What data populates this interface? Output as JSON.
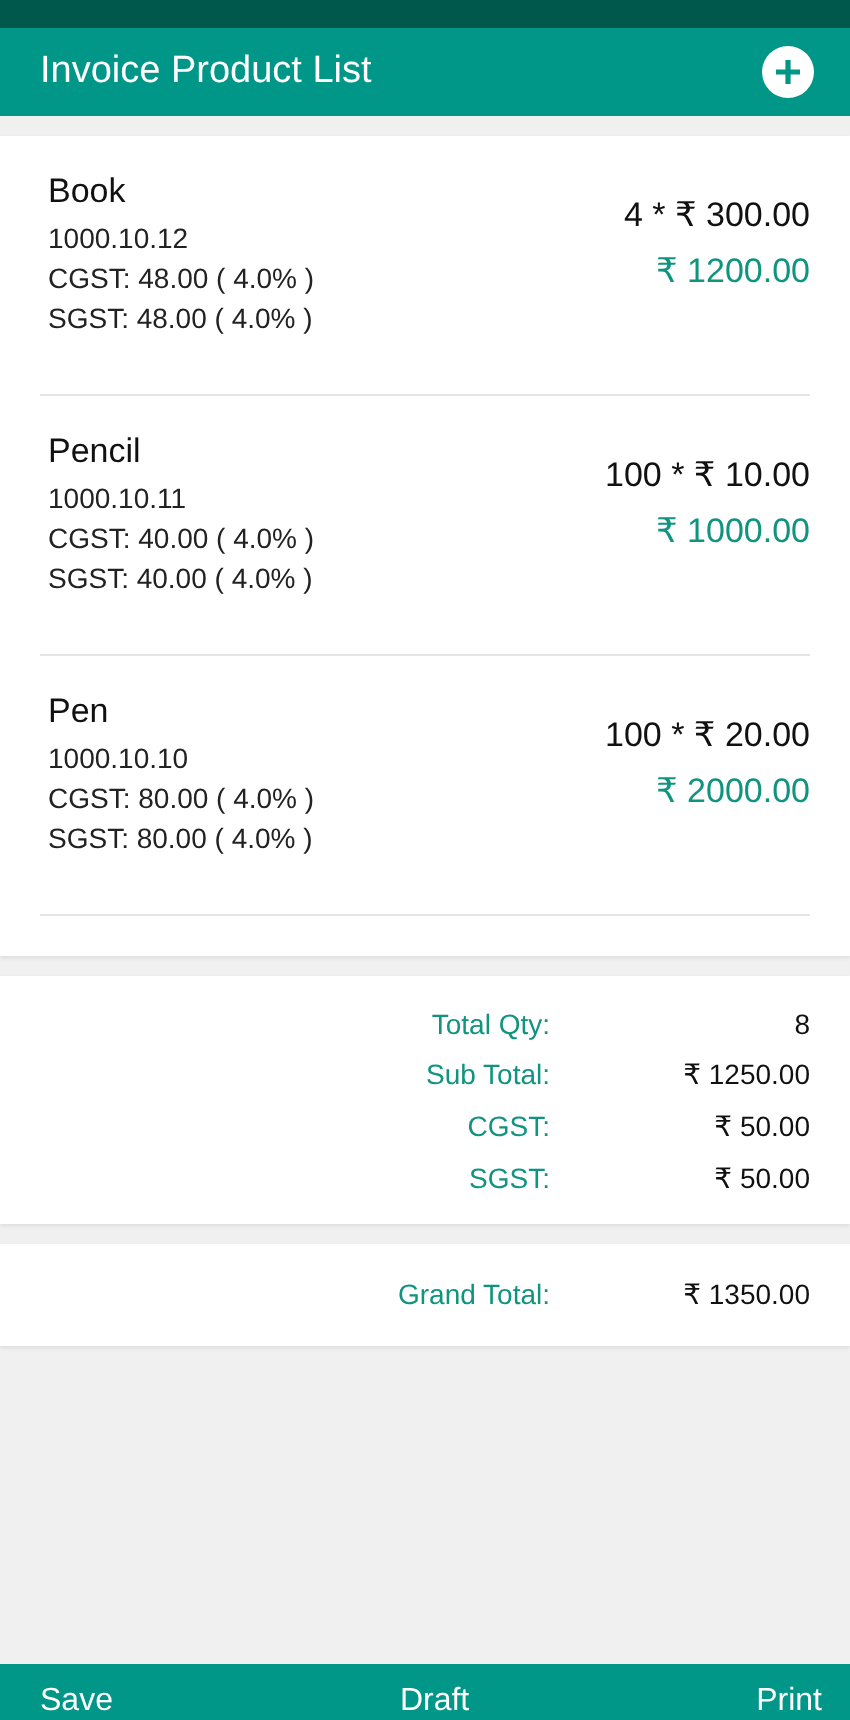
{
  "header": {
    "title": "Invoice Product List"
  },
  "products": [
    {
      "name": "Book",
      "code": "1000.10.12",
      "cgst": "CGST: 48.00 ( 4.0% )",
      "sgst": "SGST: 48.00 ( 4.0% )",
      "qty_price": "4 * ₹ 300.00",
      "amount": "₹ 1200.00"
    },
    {
      "name": "Pencil",
      "code": "1000.10.11",
      "cgst": "CGST: 40.00 ( 4.0% )",
      "sgst": "SGST: 40.00 ( 4.0% )",
      "qty_price": "100 * ₹ 10.00",
      "amount": "₹ 1000.00"
    },
    {
      "name": "Pen",
      "code": "1000.10.10",
      "cgst": "CGST: 80.00 ( 4.0% )",
      "sgst": "SGST: 80.00 ( 4.0% )",
      "qty_price": "100 * ₹ 20.00",
      "amount": "₹ 2000.00"
    }
  ],
  "totals": [
    {
      "label": "Total Qty:",
      "value": "8"
    },
    {
      "label": "Sub Total:",
      "value": "₹ 1250.00"
    },
    {
      "label": "CGST:",
      "value": "₹ 50.00"
    },
    {
      "label": "SGST:",
      "value": "₹ 50.00"
    }
  ],
  "grand_total": {
    "label": "Grand Total:",
    "value": "₹ 1350.00"
  },
  "actions": [
    "Save",
    "Draft",
    "Print"
  ]
}
